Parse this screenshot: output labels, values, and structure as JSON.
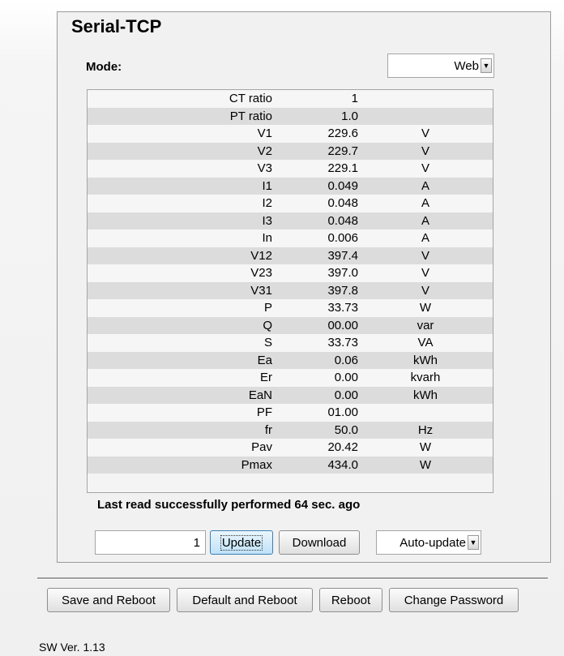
{
  "title": "Serial-TCP",
  "mode": {
    "label": "Mode:",
    "selected": "Web"
  },
  "readings": [
    {
      "label": "CT ratio",
      "value": "1",
      "unit": ""
    },
    {
      "label": "PT ratio",
      "value": "1.0",
      "unit": ""
    },
    {
      "label": "V1",
      "value": "229.6",
      "unit": "V"
    },
    {
      "label": "V2",
      "value": "229.7",
      "unit": "V"
    },
    {
      "label": "V3",
      "value": "229.1",
      "unit": "V"
    },
    {
      "label": "I1",
      "value": "0.049",
      "unit": "A"
    },
    {
      "label": "I2",
      "value": "0.048",
      "unit": "A"
    },
    {
      "label": "I3",
      "value": "0.048",
      "unit": "A"
    },
    {
      "label": "In",
      "value": "0.006",
      "unit": "A"
    },
    {
      "label": "V12",
      "value": "397.4",
      "unit": "V"
    },
    {
      "label": "V23",
      "value": "397.0",
      "unit": "V"
    },
    {
      "label": "V31",
      "value": "397.8",
      "unit": "V"
    },
    {
      "label": "P",
      "value": "33.73",
      "unit": "W"
    },
    {
      "label": "Q",
      "value": "00.00",
      "unit": "var"
    },
    {
      "label": "S",
      "value": "33.73",
      "unit": "VA"
    },
    {
      "label": "Ea",
      "value": "0.06",
      "unit": "kWh"
    },
    {
      "label": "Er",
      "value": "0.00",
      "unit": "kvarh"
    },
    {
      "label": "EaN",
      "value": "0.00",
      "unit": "kWh"
    },
    {
      "label": "PF",
      "value": "01.00",
      "unit": ""
    },
    {
      "label": "fr",
      "value": "50.0",
      "unit": "Hz"
    },
    {
      "label": "Pav",
      "value": "20.42",
      "unit": "W"
    },
    {
      "label": "Pmax",
      "value": "434.0",
      "unit": "W"
    }
  ],
  "status": "Last read successfully performed 64 sec. ago",
  "controls": {
    "count_value": "1",
    "update_label": "Update",
    "download_label": "Download",
    "auto_update_selected": "Auto-update"
  },
  "actions": {
    "save_reboot": "Save and Reboot",
    "default_reboot": "Default and Reboot",
    "reboot": "Reboot",
    "change_password": "Change Password"
  },
  "version": "SW Ver. 1.13",
  "icons": {
    "dropdown": "chevron-down-icon"
  }
}
